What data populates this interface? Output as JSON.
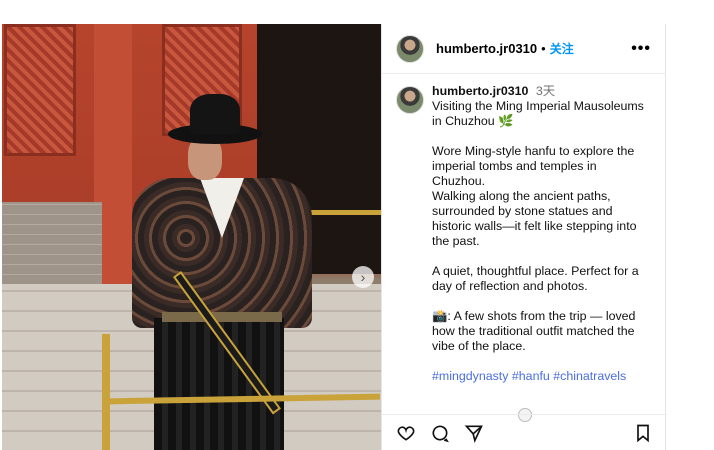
{
  "post": {
    "username": "humberto.jr0310",
    "separator": "•",
    "follow_label": "关注",
    "more_label": "•••",
    "caption": {
      "username": "humberto.jr0310",
      "time": "3天",
      "lines": [
        "Visiting the Ming Imperial Mausoleums",
        "in Chuzhou 🌿",
        "",
        "Wore Ming-style hanfu to explore the",
        "imperial tombs and temples in",
        "Chuzhou.",
        "Walking along the ancient paths,",
        "surrounded by stone statues and",
        "historic walls—it felt like stepping into",
        "the past.",
        "",
        "A quiet, thoughtful place. Perfect for a",
        "day of reflection and photos.",
        "",
        "📸: A few shots from the trip — loved",
        "how the traditional outfit matched the",
        "vibe of the place."
      ],
      "hashtags": "#mingdynasty #hanfu #chinatravels"
    },
    "photo_next_label": "›"
  },
  "icons": {
    "like": "heart-icon",
    "comment": "comment-icon",
    "share": "share-icon",
    "save": "bookmark-icon"
  },
  "colors": {
    "follow": "#0095f6",
    "hashtag": "#4a6ee0"
  }
}
